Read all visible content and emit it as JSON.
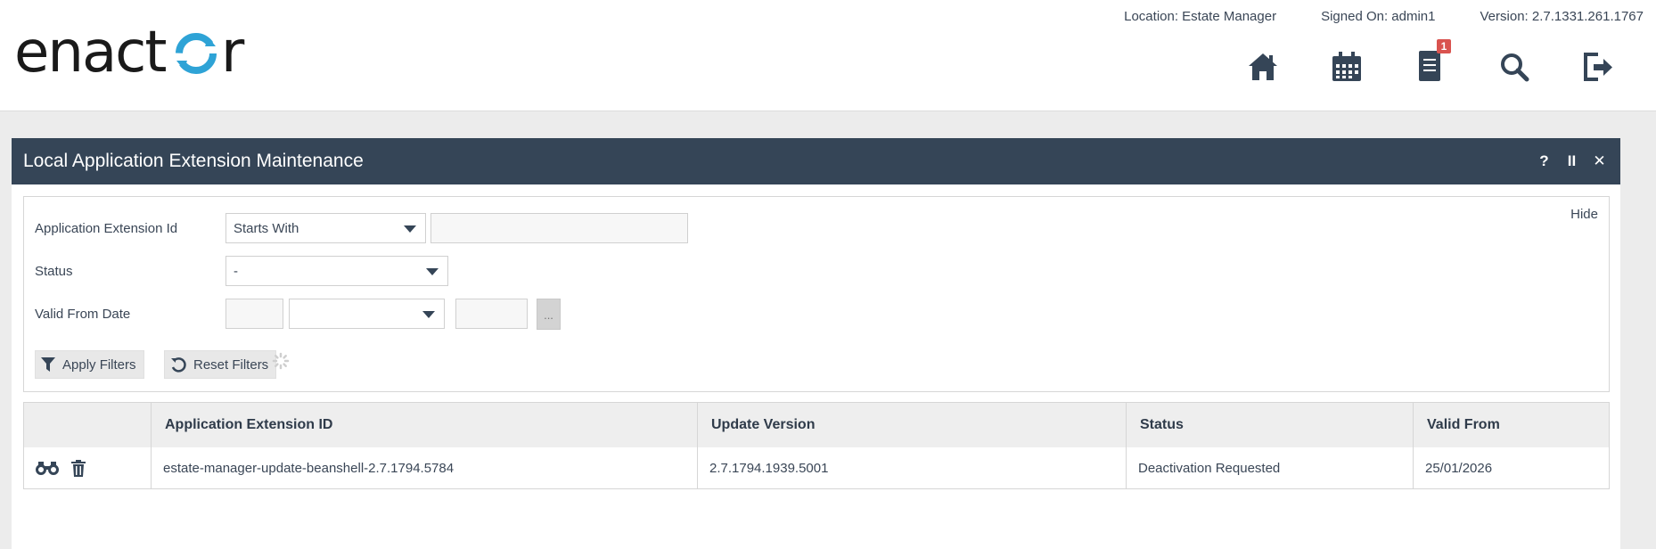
{
  "app": {
    "brand": "enactor"
  },
  "header": {
    "location": "Location: Estate Manager",
    "signed_on": "Signed On: admin1",
    "version": "Version: 2.7.1331.261.1767",
    "notifications_count": "1",
    "nav": [
      "home-icon",
      "calendar-icon",
      "notifications-icon",
      "search-icon",
      "logout-icon"
    ]
  },
  "panel": {
    "title": "Local Application Extension Maintenance",
    "actions": {
      "help": "?",
      "pause": "II",
      "close": "✕"
    }
  },
  "filters": {
    "hide_label": "Hide",
    "app_ext_id": {
      "label": "Application Extension Id",
      "operator": "Starts With",
      "value": ""
    },
    "status": {
      "label": "Status",
      "value": "-"
    },
    "valid_from": {
      "label": "Valid From Date",
      "picker_label": "..."
    },
    "apply_label": "Apply Filters",
    "reset_label": "Reset Filters"
  },
  "table": {
    "columns": [
      "",
      "Application Extension ID",
      "Update Version",
      "Status",
      "Valid From"
    ],
    "rows": [
      {
        "id": "estate-manager-update-beanshell-2.7.1794.5784",
        "update_version": "2.7.1794.1939.5001",
        "status": "Deactivation Requested",
        "valid_from": "25/01/2026"
      }
    ]
  },
  "colors": {
    "primary": "#354557",
    "accent": "#2ea3d6",
    "badge": "#d9534f"
  }
}
